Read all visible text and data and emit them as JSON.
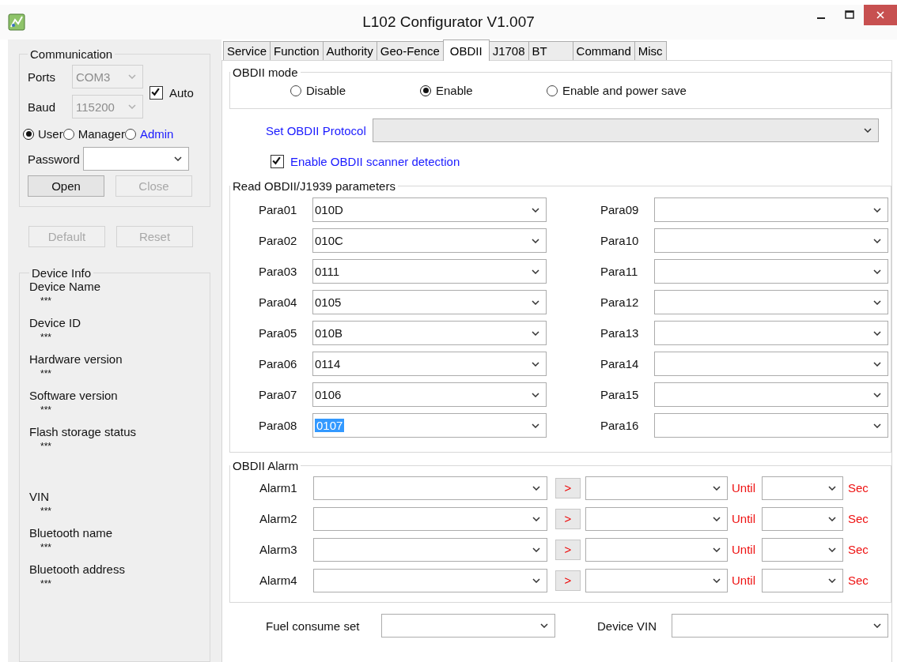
{
  "window": {
    "title": "L102 Configurator V1.007"
  },
  "communication": {
    "title": "Communication",
    "ports": {
      "label": "Ports",
      "value": "COM3",
      "disabled": true
    },
    "baud": {
      "label": "Baud",
      "value": "115200",
      "disabled": true
    },
    "auto": {
      "label": "Auto",
      "checked": true
    },
    "roles": [
      {
        "label": "User",
        "selected": true,
        "kind": "plain"
      },
      {
        "label": "Manager",
        "selected": false,
        "kind": "plain"
      },
      {
        "label": "Admin",
        "selected": false,
        "kind": "link"
      }
    ],
    "password": {
      "label": "Password"
    },
    "buttons": [
      {
        "label": "Open",
        "disabled": false
      },
      {
        "label": "Close",
        "disabled": true
      }
    ]
  },
  "actions": [
    {
      "label": "Default",
      "disabled": true
    },
    {
      "label": "Reset",
      "disabled": true
    }
  ],
  "device_info": {
    "title": "Device Info",
    "items": [
      {
        "label": "Device Name",
        "value": "***"
      },
      {
        "label": "Device ID",
        "value": "***"
      },
      {
        "label": "Hardware version",
        "value": "***"
      },
      {
        "label": "Software version",
        "value": "***"
      },
      {
        "label": "Flash storage status",
        "value": "***"
      },
      {
        "label": "VIN",
        "value": "***"
      },
      {
        "label": "Bluetooth name",
        "value": "***"
      },
      {
        "label": "Bluetooth address",
        "value": "***"
      }
    ]
  },
  "tabs": [
    {
      "label": "Service",
      "selected": false
    },
    {
      "label": "Function",
      "selected": false
    },
    {
      "label": "Authority",
      "selected": false
    },
    {
      "label": "Geo-Fence",
      "selected": false
    },
    {
      "label": "OBDII",
      "selected": true
    },
    {
      "label": "J1708",
      "selected": false
    },
    {
      "label": "BT",
      "selected": false
    },
    {
      "label": "Command",
      "selected": false
    },
    {
      "label": "Misc",
      "selected": false
    }
  ],
  "obd_mode": {
    "title": "OBDII mode",
    "options": [
      {
        "label": "Disable",
        "selected": false
      },
      {
        "label": "Enable",
        "selected": true
      },
      {
        "label": "Enable and power save",
        "selected": false
      }
    ]
  },
  "protocol": {
    "label": "Set OBDII Protocol"
  },
  "scanner_detection": {
    "label": "Enable OBDII scanner detection",
    "checked": true
  },
  "params": {
    "title": "Read OBDII/J1939 parameters",
    "items": [
      {
        "label": "Para01",
        "value": "010D",
        "highlighted": false
      },
      {
        "label": "Para02",
        "value": "010C",
        "highlighted": false
      },
      {
        "label": "Para03",
        "value": "0111",
        "highlighted": false
      },
      {
        "label": "Para04",
        "value": "0105",
        "highlighted": false
      },
      {
        "label": "Para05",
        "value": "010B",
        "highlighted": false
      },
      {
        "label": "Para06",
        "value": "0114",
        "highlighted": false
      },
      {
        "label": "Para07",
        "value": "0106",
        "highlighted": false
      },
      {
        "label": "Para08",
        "value": "0107",
        "highlighted": true
      },
      {
        "label": "Para09",
        "value": "",
        "highlighted": false
      },
      {
        "label": "Para10",
        "value": "",
        "highlighted": false
      },
      {
        "label": "Para11",
        "value": "",
        "highlighted": false
      },
      {
        "label": "Para12",
        "value": "",
        "highlighted": false
      },
      {
        "label": "Para13",
        "value": "",
        "highlighted": false
      },
      {
        "label": "Para14",
        "value": "",
        "highlighted": false
      },
      {
        "label": "Para15",
        "value": "",
        "highlighted": false
      },
      {
        "label": "Para16",
        "value": "",
        "highlighted": false
      }
    ]
  },
  "alarm": {
    "title": "OBDII Alarm",
    "rows": [
      {
        "label": "Alarm1",
        "operator": ">",
        "until": "Until",
        "unit": "Sec"
      },
      {
        "label": "Alarm2",
        "operator": ">",
        "until": "Until",
        "unit": "Sec"
      },
      {
        "label": "Alarm3",
        "operator": ">",
        "until": "Until",
        "unit": "Sec"
      },
      {
        "label": "Alarm4",
        "operator": ">",
        "until": "Until",
        "unit": "Sec"
      }
    ]
  },
  "fuel": {
    "label": "Fuel consume set"
  },
  "device_vin": {
    "label": "Device VIN"
  }
}
